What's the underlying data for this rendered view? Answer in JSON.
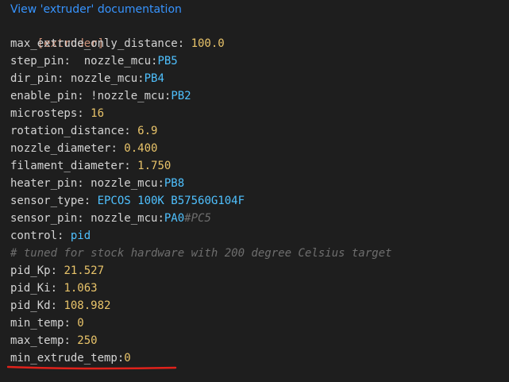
{
  "doc_link": "View 'extruder' documentation",
  "lines": {
    "section": "[extruder]",
    "max_extrude_only_distance": {
      "key": "max_extrude_only_distance",
      "value": "100.0"
    },
    "step_pin": {
      "key": "step_pin",
      "sep": ":  ",
      "prefix": "nozzle_mcu:",
      "value": "PB5"
    },
    "dir_pin": {
      "key": "dir_pin",
      "prefix": "nozzle_mcu:",
      "value": "PB4"
    },
    "enable_pin": {
      "key": "enable_pin",
      "prefix": "!nozzle_mcu:",
      "value": "PB2"
    },
    "microsteps": {
      "key": "microsteps",
      "value": "16"
    },
    "rotation_distance": {
      "key": "rotation_distance",
      "value": "6.9"
    },
    "nozzle_diameter": {
      "key": "nozzle_diameter",
      "value": "0.400"
    },
    "filament_diameter": {
      "key": "filament_diameter",
      "value": "1.750"
    },
    "heater_pin": {
      "key": "heater_pin",
      "prefix": "nozzle_mcu:",
      "value": "PB8"
    },
    "sensor_type": {
      "key": "sensor_type",
      "value": "EPCOS 100K B57560G104F"
    },
    "sensor_pin": {
      "key": "sensor_pin",
      "prefix": "nozzle_mcu:",
      "value": "PA0",
      "comment": "#PC5"
    },
    "control": {
      "key": "control",
      "value": "pid"
    },
    "comment": "# tuned for stock hardware with 200 degree Celsius target",
    "pid_Kp": {
      "key": "pid_Kp",
      "value": "21.527"
    },
    "pid_Ki": {
      "key": "pid_Ki",
      "value": "1.063"
    },
    "pid_Kd": {
      "key": "pid_Kd",
      "value": "108.982"
    },
    "min_temp": {
      "key": "min_temp",
      "value": "0"
    },
    "max_temp": {
      "key": "max_temp",
      "value": "250"
    },
    "min_extrude_temp": {
      "key": "min_extrude_temp",
      "value": "0"
    }
  },
  "colors": {
    "background": "#1e1e1e",
    "link": "#3794ff",
    "section": "#ce9178",
    "number": "#e9c46a",
    "pin": "#4fc1ff",
    "comment": "#6a9955",
    "underline_annotation": "#e0221b"
  }
}
